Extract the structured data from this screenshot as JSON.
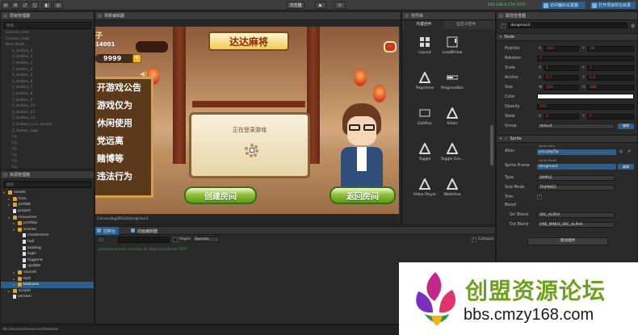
{
  "toolbar": {
    "play_mode": "浏览器",
    "play_icon": "▶",
    "refresh_icon": "↻",
    "address": "192.168.0.174:7457",
    "preview_tab": "访问偏好设置器",
    "build_tab": "打开项目所在目录",
    "left_icons": [
      "⇄",
      "⟲",
      "⤢",
      "▢"
    ]
  },
  "hierarchy": {
    "title": "层级管理器",
    "search_placeholder": "搜索...",
    "items": [
      "Canvas_new",
      "Canvas_new",
      "New Node",
      "2_button_2",
      "2_button_1",
      "2_button_3",
      "2_button_4",
      "2_button_5",
      "2_button_6",
      "2_button_7",
      "2_button_8",
      "2_button_9",
      "2_button_10",
      "2_button_11",
      "2_button_12",
      "2_button_Line_weight",
      "2_button_logo",
      "bg",
      "bg",
      "bg",
      "bg",
      "bg",
      "bg",
      "label",
      "Background",
      "Scroll_item",
      "New Label"
    ]
  },
  "assets": {
    "title": "资源管理器",
    "search_placeholder": "搜索",
    "items": [
      {
        "label": "assets",
        "kind": "folder",
        "indent": 0,
        "open": true
      },
      {
        "label": "Icon",
        "kind": "folder",
        "indent": 1,
        "open": false
      },
      {
        "label": "prefab",
        "kind": "folder",
        "indent": 1,
        "open": false
      },
      {
        "label": "project",
        "kind": "file",
        "indent": 1,
        "open": false
      },
      {
        "label": "resources",
        "kind": "folder",
        "indent": 1,
        "open": true
      },
      {
        "label": "prefabs",
        "kind": "folder",
        "indent": 2,
        "open": false
      },
      {
        "label": "scenes",
        "kind": "folder",
        "indent": 2,
        "open": true
      },
      {
        "label": "createroom",
        "kind": "file",
        "indent": 3,
        "open": false
      },
      {
        "label": "hall",
        "kind": "file",
        "indent": 3,
        "open": false
      },
      {
        "label": "loading",
        "kind": "file",
        "indent": 3,
        "open": false
      },
      {
        "label": "login",
        "kind": "file",
        "indent": 3,
        "open": false
      },
      {
        "label": "mjgame",
        "kind": "file",
        "indent": 3,
        "open": false
      },
      {
        "label": "update",
        "kind": "file",
        "indent": 3,
        "open": false
      },
      {
        "label": "sounds",
        "kind": "folder",
        "indent": 2,
        "open": false
      },
      {
        "label": "test",
        "kind": "folder",
        "indent": 2,
        "open": false
      },
      {
        "label": "textures",
        "kind": "folder",
        "indent": 2,
        "open": false,
        "selected": true
      },
      {
        "label": "scripts",
        "kind": "folder",
        "indent": 1,
        "open": false
      },
      {
        "label": "version",
        "kind": "file",
        "indent": 1,
        "open": false
      }
    ],
    "status_path": "db://assets/resources/textures"
  },
  "scene": {
    "title": "场景编辑器",
    "path": "Canvas/bg/BG/ptdongmao3",
    "game_title": "达达麻将",
    "player_name": "子",
    "player_id": "14001",
    "gold": "9999",
    "board_lines": [
      "开游戏公告",
      "游戏仅为",
      "休闲使用",
      "党远离",
      "赌博等",
      "违法行为"
    ],
    "modal_text": "正在登录游戏",
    "btn_create": "创建房间",
    "btn_back": "返回房间"
  },
  "widgets": {
    "title": "控件库",
    "tab_builtin": "内置控件",
    "tab_custom": "自定义控件",
    "items": [
      {
        "label": "Layout",
        "icon": "layout"
      },
      {
        "label": "LoadBView",
        "icon": "scroll"
      },
      {
        "label": "PageView",
        "icon": "triangle"
      },
      {
        "label": "ProgressBar",
        "icon": "bar"
      },
      {
        "label": "EditBox",
        "icon": "box"
      },
      {
        "label": "Slider",
        "icon": "triangle"
      },
      {
        "label": "Toggle",
        "icon": "triangle"
      },
      {
        "label": "Toggle Gro...",
        "icon": "triangle"
      },
      {
        "label": "Video Player",
        "icon": "triangle"
      },
      {
        "label": "WebView",
        "icon": "triangle"
      }
    ]
  },
  "console": {
    "tab_console": "控制台",
    "tab_anim": "动画编辑器",
    "regex_label": "Regex",
    "level": "Success",
    "collapse_label": "Collapse",
    "log": "preview server running at: http://localhost:7457"
  },
  "properties": {
    "title": "属性检查器",
    "node_name": "dongmao3",
    "node_section": "Node",
    "rows": {
      "position_label": "Position",
      "pos_x": "-443",
      "pos_y": "18",
      "rotation_label": "Rotation",
      "rotation": "0",
      "scale_label": "Scale",
      "scale_x": "1",
      "scale_y": "1",
      "anchor_label": "Anchor",
      "anchor_x": "0.5",
      "anchor_y": "0.5",
      "size_label": "Size",
      "size_w": "226",
      "size_h": "388",
      "color_label": "Color",
      "opacity_label": "Opacity",
      "opacity": "255",
      "skew_label": "Skew",
      "skew_x": "0",
      "skew_y": "0",
      "group_label": "Group",
      "group": "default",
      "edit_label": "编辑"
    },
    "sprite_section": "Sprite",
    "sprite": {
      "atlas_label": "Atlas",
      "atlas_tag": "sprite-atlas",
      "atlas_value": "ysccpkgTip",
      "frame_label": "Sprite Frame",
      "frame_tag": "sprite-frame",
      "frame_value": "dongmao3",
      "type_label": "Type",
      "type": "SIMPLE",
      "sizemode_label": "Size Mode",
      "sizemode": "TRIMMED",
      "trim_label": "Trim",
      "blend_label": "Blend",
      "src_label": "Src Blend",
      "src": "SRC_ALPHA",
      "dst_label": "Dst Blend",
      "dst": "ONE_MINUS_SRC_ALPHA",
      "edit_label": "编辑"
    },
    "add_component": "添加组件"
  },
  "watermark": {
    "title": "创盟资源论坛",
    "url": "bbs.cmzy168.com"
  },
  "colors": {
    "accent": "#2b5f8d",
    "red_value": "#d84a3a",
    "panel": "#2a2a2a"
  }
}
